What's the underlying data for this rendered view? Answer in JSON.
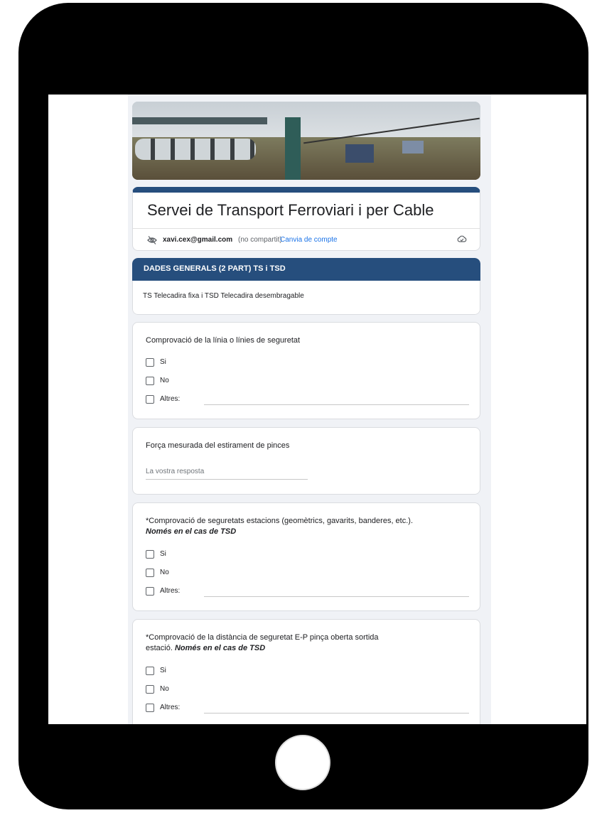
{
  "form": {
    "title": "Servei de Transport Ferroviari i per Cable",
    "account": {
      "email": "xavi.cex@gmail.com",
      "note": "(no compartit)",
      "switch_link": "Canvia de compte"
    },
    "section": {
      "title": "DADES GENERALS (2 PART) TS i TSD",
      "description": "TS Telecadira fixa i TSD Telecadira desembragable"
    },
    "questions": [
      {
        "title": "Comprovació de la línia o línies de seguretat",
        "options": [
          "Si",
          "No",
          "Altres:"
        ]
      },
      {
        "title": "Força mesurada del estirament de pinces",
        "placeholder": "La vostra resposta"
      },
      {
        "title": "*Comprovació de seguretats estacions (geomètrics, gavarits, banderes, etc.).",
        "note": "Només en el cas de TSD",
        "options": [
          "Si",
          "No",
          "Altres:"
        ]
      },
      {
        "title_line1": "*Comprovació de la distància de seguretat E-P pinça oberta sortida",
        "title_line2": "estació.",
        "note": "Només en el cas de TSD",
        "options": [
          "Si",
          "No",
          "Altres:"
        ]
      }
    ]
  },
  "icons": {
    "visibility": "eye-off-icon",
    "cloud": "cloud-saved-icon"
  },
  "colors": {
    "accent": "#264e7d",
    "background": "#f0f2f6",
    "link": "#1a73e8",
    "device": "#000000"
  }
}
